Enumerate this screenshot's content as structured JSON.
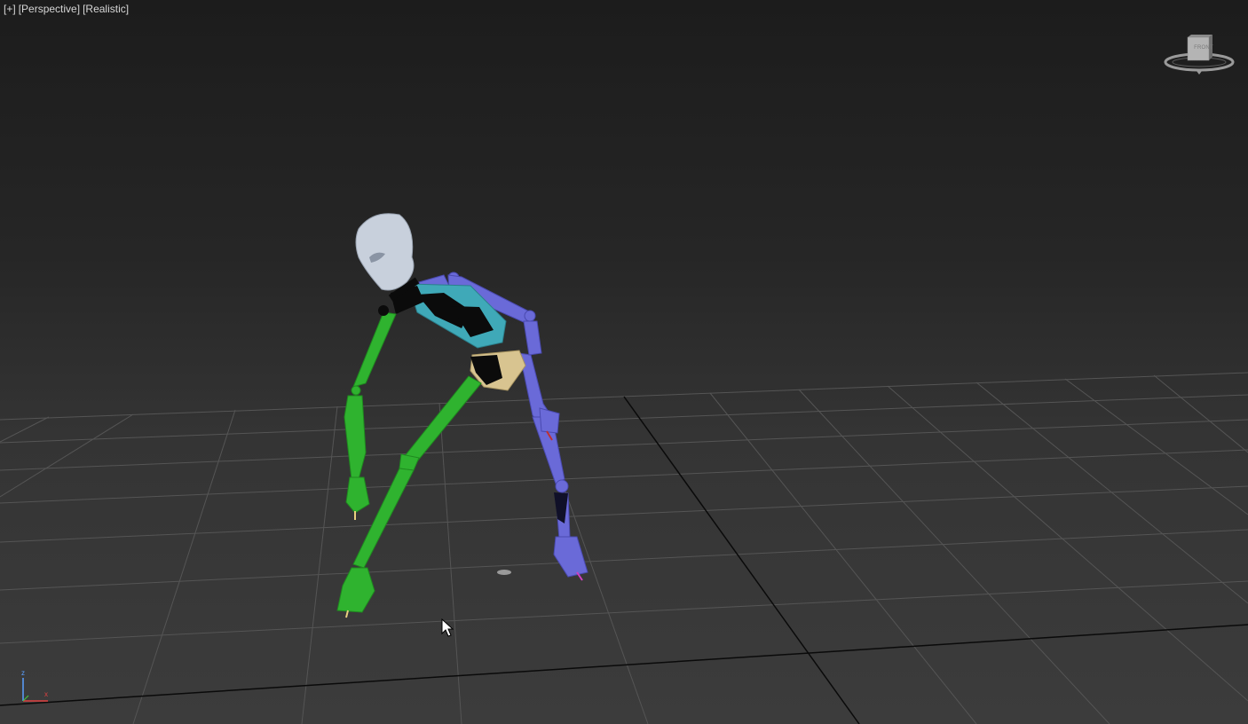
{
  "viewport": {
    "labels": {
      "plus": "[+]",
      "view": "[Perspective]",
      "shading": "[Realistic]"
    },
    "background_top": "#1c1c1c",
    "background_bottom": "#3c3c3c",
    "grid_color": "#555555",
    "grid_axis_color": "#000000"
  },
  "viewcube": {
    "face_label": "FRONT"
  },
  "axis_tripod": {
    "z": "z",
    "x": "x",
    "z_color": "#5aa0ff",
    "x_color": "#e04040"
  },
  "character": {
    "head_color": "#c8d0dc",
    "spine_color": "#3fa9b8",
    "left_limbs_color": "#2fb32f",
    "right_limbs_color": "#6a6ad8",
    "pelvis_color": "#d8c490"
  },
  "icons": {
    "cursor": "mouse-pointer-icon",
    "viewcube": "viewcube-icon",
    "tripod": "axis-tripod-icon"
  }
}
